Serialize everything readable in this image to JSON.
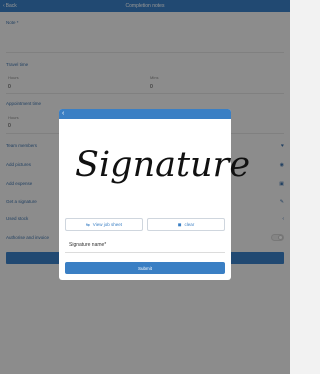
{
  "topbar": {
    "back_label": "Back",
    "title": "Completion notes"
  },
  "note": {
    "label": "Note *"
  },
  "travel_time": {
    "section": "Travel time",
    "hours_label": "Hours",
    "hours_value": "0",
    "mins_label": "Mins",
    "mins_value": "0"
  },
  "appointment_time": {
    "section": "Appointment time",
    "hours_label": "Hours",
    "hours_value": "0"
  },
  "rows": {
    "team_members": "Team members",
    "add_pictures": "Add pictures",
    "add_expense": "Add expense",
    "get_signature": "Get a signature",
    "used_stock": "Used stock",
    "authorise_invoice": "Authorise and invoice"
  },
  "modal": {
    "back_icon": "chevron-left-icon",
    "signature_text": "Signature",
    "view_job_sheet_label": "View job sheet",
    "clear_label": "clear",
    "signature_name_label": "Signature name*",
    "submit_label": "Submit"
  },
  "colors": {
    "accent": "#3a7fc4",
    "overlay": "rgba(0,0,0,0.42)"
  }
}
